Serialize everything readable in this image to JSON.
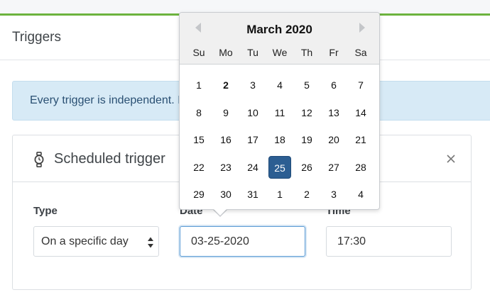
{
  "page": {
    "title": "Triggers"
  },
  "alert": {
    "text": "Every trigger is independent. If any trigger occurs, the scene will run."
  },
  "card": {
    "title": "Scheduled trigger",
    "type_label": "Type",
    "type_value": "On a specific day",
    "date_label": "Date",
    "date_value": "03-25-2020",
    "time_label": "Time",
    "time_value": "17:30"
  },
  "datepicker": {
    "title": "March 2020",
    "weekdays": [
      "Su",
      "Mo",
      "Tu",
      "We",
      "Th",
      "Fr",
      "Sa"
    ],
    "weeks": [
      [
        "1",
        "2",
        "3",
        "4",
        "5",
        "6",
        "7"
      ],
      [
        "8",
        "9",
        "10",
        "11",
        "12",
        "13",
        "14"
      ],
      [
        "15",
        "16",
        "17",
        "18",
        "19",
        "20",
        "21"
      ],
      [
        "22",
        "23",
        "24",
        "25",
        "26",
        "27",
        "28"
      ],
      [
        "29",
        "30",
        "31",
        "1",
        "2",
        "3",
        "4"
      ]
    ],
    "bold_day": "2",
    "selected_day": "25"
  },
  "icons": {
    "card": "watch-icon",
    "close": "close-icon",
    "select": "sort-arrows-icon",
    "prev": "chevron-left-icon",
    "next": "chevron-right-icon"
  },
  "colors": {
    "accent_bar": "#6cb33e",
    "alert_bg": "#d7eaf6",
    "selected_day": "#2c5e92",
    "focus": "#5b9bd5"
  }
}
